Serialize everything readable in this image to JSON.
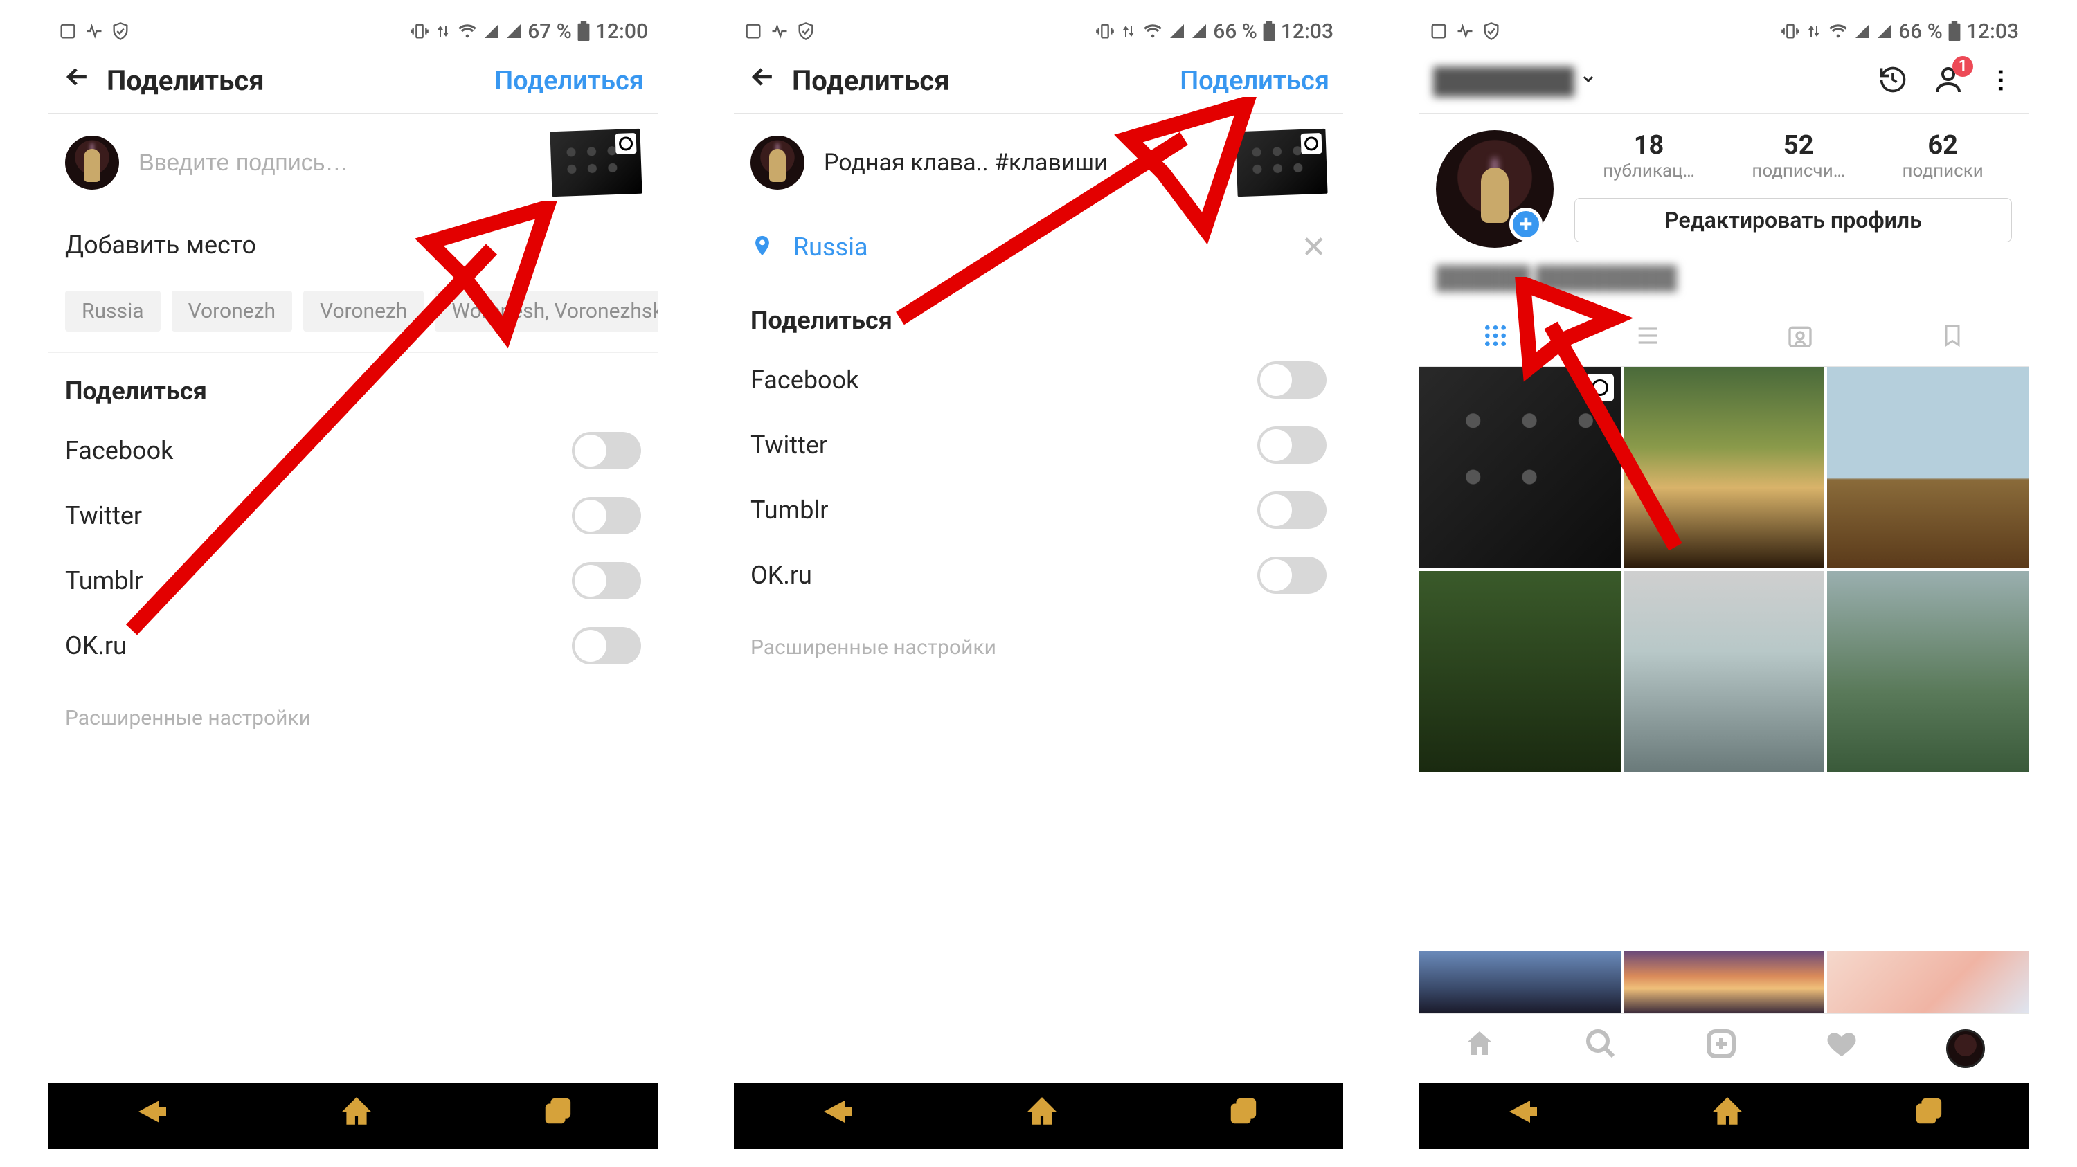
{
  "status1": {
    "battery": "67 %",
    "time": "12:00"
  },
  "status2": {
    "battery": "66 %",
    "time": "12:03"
  },
  "status3": {
    "battery": "66 %",
    "time": "12:03"
  },
  "header": {
    "title": "Поделиться",
    "action": "Поделиться"
  },
  "caption": {
    "placeholder": "Введите подпись…",
    "text": "Родная клава.. #клавиши"
  },
  "location": {
    "add_label": "Добавить место",
    "selected": "Russia",
    "clear": "✕",
    "suggestions": [
      "Russia",
      "Voronezh",
      "Voronezh",
      "Woronesh, Voronezhska…"
    ]
  },
  "share": {
    "heading": "Поделиться",
    "items": [
      "Facebook",
      "Twitter",
      "Tumblr",
      "OK.ru"
    ]
  },
  "advanced": "Расширенные настройки",
  "profile": {
    "username": "████████",
    "history_icon": "history",
    "add_user_icon": "add-user",
    "badge": "1",
    "stats": {
      "posts": {
        "num": "18",
        "label": "публикац…"
      },
      "followers": {
        "num": "52",
        "label": "подписчи…"
      },
      "following": {
        "num": "62",
        "label": "подписки"
      }
    },
    "edit_button": "Редактировать профиль",
    "bio": "██████ █████████"
  }
}
